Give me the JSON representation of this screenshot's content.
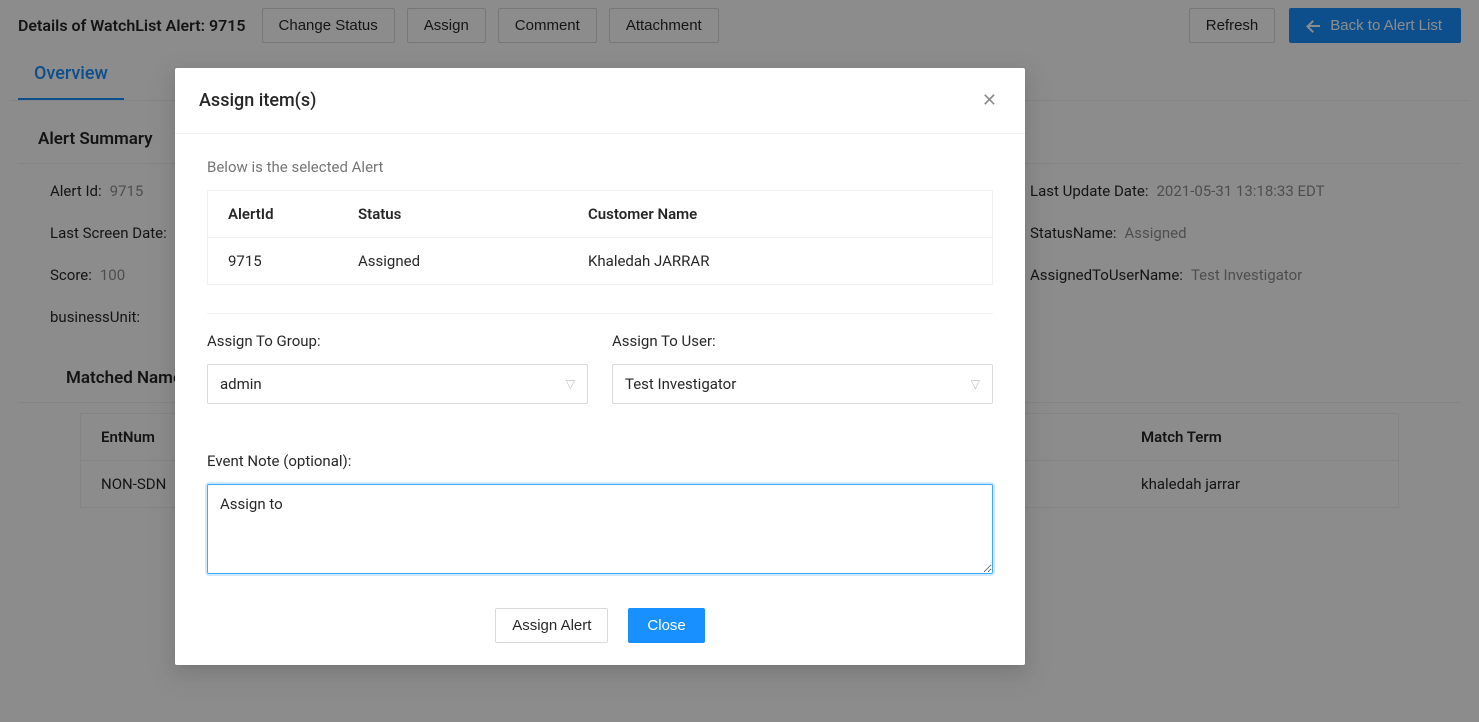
{
  "header": {
    "title": "Details of WatchList Alert: 9715",
    "buttons": {
      "change_status": "Change Status",
      "assign": "Assign",
      "comment": "Comment",
      "attachment": "Attachment",
      "refresh": "Refresh",
      "back": "Back to Alert List"
    }
  },
  "tabs": {
    "overview": "Overview"
  },
  "summary": {
    "title": "Alert Summary",
    "alert_id_lbl": "Alert Id:",
    "alert_id_val": "9715",
    "last_update_lbl": "Last Update Date:",
    "last_update_val": "2021-05-31 13:18:33 EDT",
    "last_screen_lbl": "Last Screen Date:",
    "status_lbl": "StatusName:",
    "status_val": "Assigned",
    "score_lbl": "Score:",
    "score_val": "100",
    "assigned_lbl": "AssignedToUserName:",
    "assigned_val": "Test Investigator",
    "bu_lbl": "businessUnit:"
  },
  "matched": {
    "title": "Matched Names",
    "col1": "EntNum",
    "col2": "Match Term",
    "row1_c1": "NON-SDN",
    "row1_c2": "khaledah jarrar"
  },
  "modal": {
    "title": "Assign item(s)",
    "intro": "Below is the selected Alert",
    "table": {
      "h1": "AlertId",
      "h2": "Status",
      "h3": "Customer Name",
      "r1c1": "9715",
      "r1c2": "Assigned",
      "r1c3": "Khaledah JARRAR"
    },
    "group_lbl": "Assign To Group:",
    "group_val": "admin",
    "user_lbl": "Assign To User:",
    "user_val": "Test Investigator",
    "note_lbl": "Event Note (optional):",
    "note_val": "Assign to",
    "assign_btn": "Assign Alert",
    "close_btn": "Close"
  }
}
